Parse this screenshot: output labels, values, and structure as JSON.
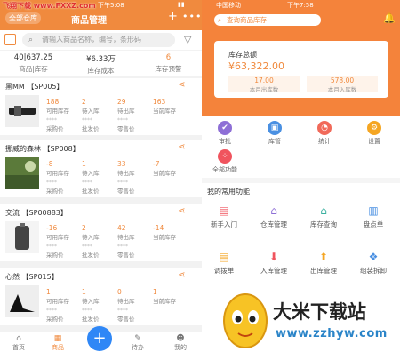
{
  "left": {
    "watermark": "飞翔下载 www.FXXZ.com",
    "status_time": "下午5:08",
    "store_label": "全部仓库",
    "title": "商品管理",
    "search_placeholder": "请输入商品名称，编号，条形码",
    "summary": [
      {
        "value": "40|637.25",
        "label": "商品|库存"
      },
      {
        "value": "¥6.33万",
        "label": "库存成本"
      },
      {
        "value": "6",
        "label": "库存预警"
      }
    ],
    "products": [
      {
        "name": "黑MM 【SP005】",
        "stats": [
          {
            "value": "188",
            "label": "可用库存"
          },
          {
            "value": "2",
            "label": "待入库"
          },
          {
            "value": "29",
            "label": "待出库"
          },
          {
            "value": "163",
            "label": "当前库存"
          }
        ],
        "prices": [
          {
            "value": "****",
            "label": "采购价"
          },
          {
            "value": "****",
            "label": "批发价"
          },
          {
            "value": "****",
            "label": "零售价"
          }
        ]
      },
      {
        "name": "挪威的森林 【SP008】",
        "stats": [
          {
            "value": "-8",
            "label": "可用库存"
          },
          {
            "value": "1",
            "label": "待入库"
          },
          {
            "value": "33",
            "label": "待出库"
          },
          {
            "value": "-7",
            "label": "当前库存"
          }
        ],
        "prices": [
          {
            "value": "****",
            "label": "采购价"
          },
          {
            "value": "****",
            "label": "批发价"
          },
          {
            "value": "****",
            "label": "零售价"
          }
        ]
      },
      {
        "name": "交流 【SP00883】",
        "stats": [
          {
            "value": "-16",
            "label": "可用库存"
          },
          {
            "value": "2",
            "label": "待入库"
          },
          {
            "value": "42",
            "label": "待出库"
          },
          {
            "value": "-14",
            "label": "当前库存"
          }
        ],
        "prices": [
          {
            "value": "****",
            "label": "采购价"
          },
          {
            "value": "****",
            "label": "批发价"
          },
          {
            "value": "****",
            "label": "零售价"
          }
        ]
      },
      {
        "name": "心然 【SP015】",
        "stats": [
          {
            "value": "1",
            "label": "可用库存"
          },
          {
            "value": "1",
            "label": "待入库"
          },
          {
            "value": "0",
            "label": "待出库"
          },
          {
            "value": "1",
            "label": "当前库存"
          }
        ],
        "prices": [
          {
            "value": "****",
            "label": "采购价"
          },
          {
            "value": "****",
            "label": "批发价"
          },
          {
            "value": "****",
            "label": "零售价"
          }
        ]
      }
    ],
    "tabs": [
      "首页",
      "商品",
      "",
      "待办",
      "我的"
    ]
  },
  "right": {
    "status_left": "中国移动",
    "status_time": "下午7:58",
    "search_label": "查询商品库存",
    "inventory_label": "库存总额",
    "inventory_value": "¥63,322.00",
    "sub": [
      {
        "value": "17.00",
        "label": "本月出库数"
      },
      {
        "value": "578.00",
        "label": "本月入库数"
      }
    ],
    "quick": [
      "审批",
      "库管",
      "统计",
      "设置",
      "全部功能"
    ],
    "common_title": "我的常用功能",
    "common": [
      "新手入门",
      "仓库管理",
      "库存查询",
      "盘点单",
      "调拨单",
      "入库管理",
      "出库管理",
      "组装拆卸"
    ]
  },
  "brand": {
    "name": "大米下载站",
    "url": "www.zzhyw.com"
  },
  "colors": {
    "accent": "#f08a3e",
    "fab": "#2f87f6"
  }
}
